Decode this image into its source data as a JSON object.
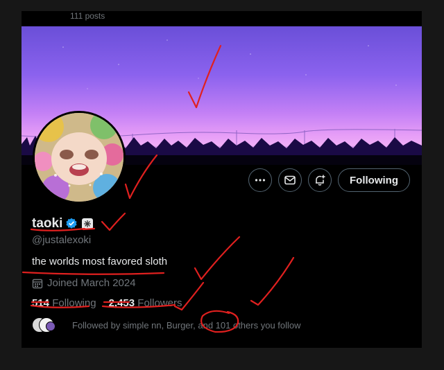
{
  "topbar": {
    "posts_label": "111 posts"
  },
  "profile": {
    "display_name": "taoki",
    "handle": "@justalexoki",
    "bio": "the worlds most favored sloth",
    "joined": "Joined March 2024",
    "following_count": "514",
    "following_label": "Following",
    "followers_count": "2,453",
    "followers_label": "Followers",
    "followed_by": "Followed by simple nn, Burger, and 101 others you follow"
  },
  "actions": {
    "follow_button_label": "Following",
    "more_icon": "more-icon",
    "message_icon": "mail-icon",
    "notify_icon": "bell-plus-icon"
  },
  "colors": {
    "verified": "#1d9bf0",
    "annotation": "#e0201f",
    "muted": "#71767b"
  }
}
